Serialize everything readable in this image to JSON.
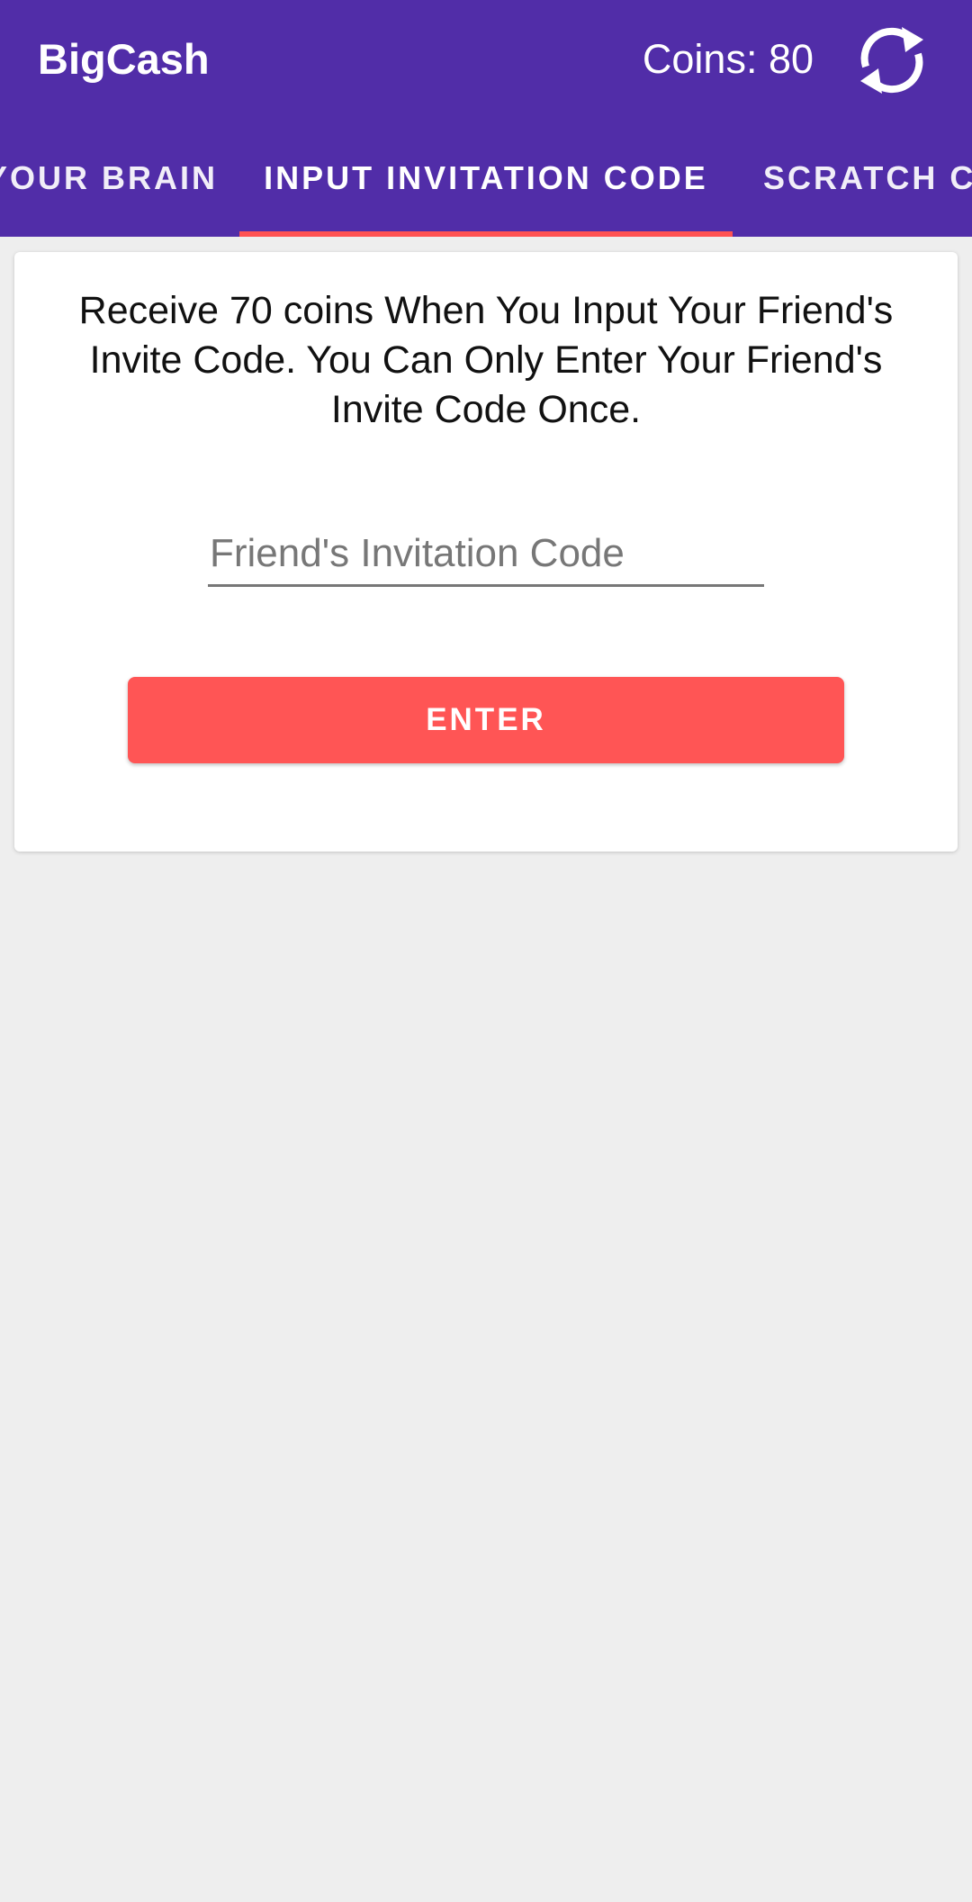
{
  "toolbar": {
    "title": "BigCash",
    "coins_text": "Coins: 80",
    "refresh_icon": "refresh-icon"
  },
  "tabs": [
    {
      "label": "YOUR BRAIN",
      "active": false
    },
    {
      "label": "INPUT INVITATION CODE",
      "active": true
    },
    {
      "label": "SCRATCH CA",
      "active": false
    }
  ],
  "card": {
    "info_text": "Receive 70 coins When You Input Your Friend's Invite Code. You Can Only Enter Your Friend's Invite Code Once.",
    "input_placeholder": "Friend's Invitation Code",
    "input_value": "",
    "enter_label": "ENTER"
  },
  "colors": {
    "primary": "#512da8",
    "accent": "#ff5252",
    "button": "#ff5555",
    "background": "#eeeeee"
  }
}
